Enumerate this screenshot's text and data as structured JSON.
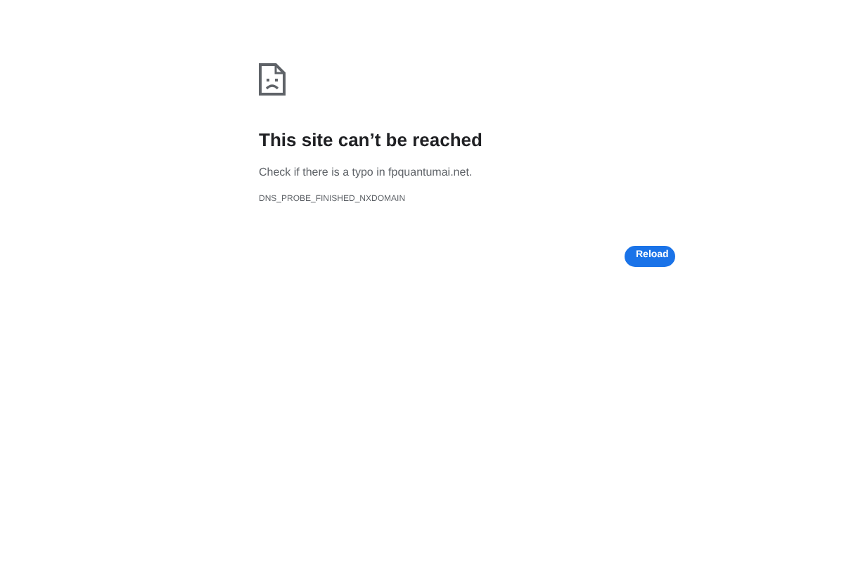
{
  "error": {
    "title": "This site can’t be reached",
    "message": "Check if there is a typo in fpquantumai.net.",
    "code": "DNS_PROBE_FINISHED_NXDOMAIN"
  },
  "buttons": [
    "Reload"
  ]
}
